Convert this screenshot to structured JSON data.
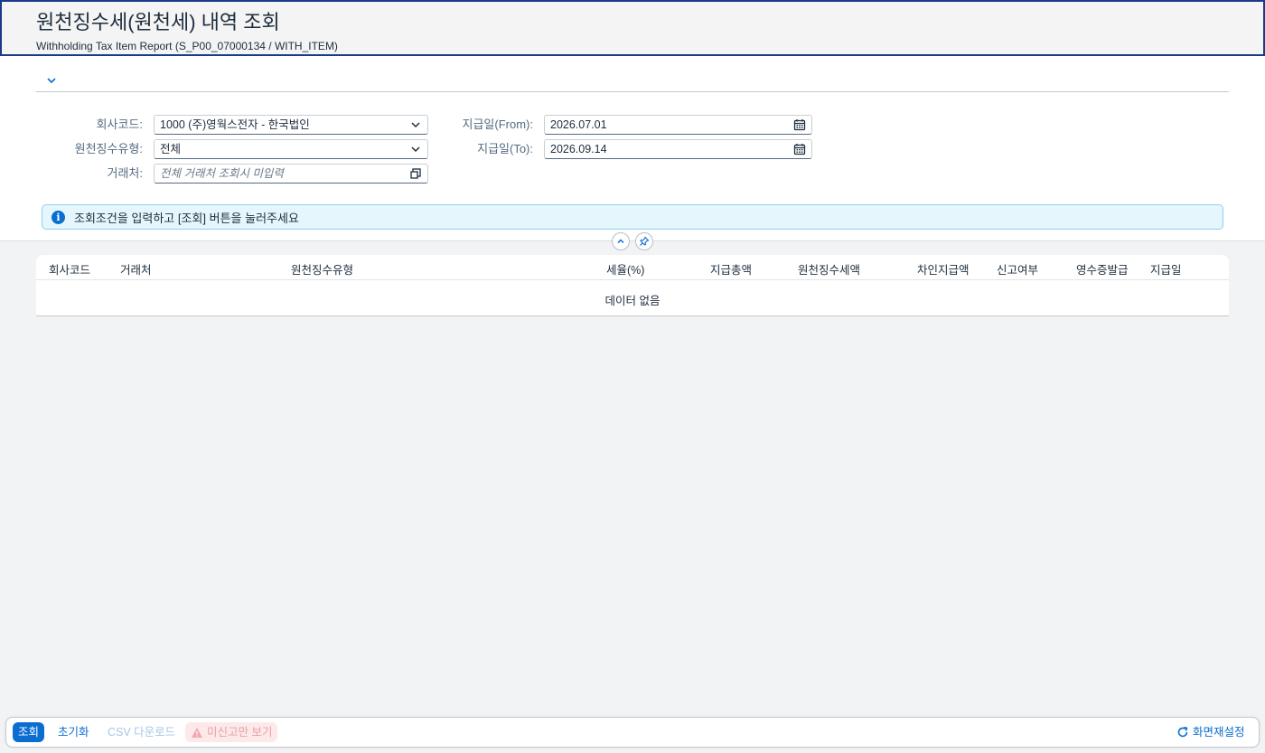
{
  "header": {
    "title": "원천징수세(원천세) 내역 조회",
    "subtitle": "Withholding Tax Item Report (S_P00_07000134 / WITH_ITEM)"
  },
  "filters": {
    "company_code": {
      "label": "회사코드:",
      "value": "1000 (주)영웍스전자 - 한국법인",
      "icon": "chevron-down-icon"
    },
    "withholding_type": {
      "label": "원천징수유형:",
      "value": "전체",
      "icon": "chevron-down-icon"
    },
    "vendor": {
      "label": "거래처:",
      "placeholder": "전체 거래처 조회시 미입력",
      "icon": "value-help-icon"
    },
    "pay_date_from": {
      "label": "지급일(From):",
      "value": "2026.07.01",
      "icon": "calendar-icon"
    },
    "pay_date_to": {
      "label": "지급일(To):",
      "value": "2026.09.14",
      "icon": "calendar-icon"
    }
  },
  "info_strip": {
    "icon": "info-icon",
    "text": "조회조건을 입력하고 [조회] 버튼을 눌러주세요"
  },
  "table": {
    "columns": [
      "회사코드",
      "거래처",
      "원천징수유형",
      "세율(%)",
      "지급총액",
      "원천징수세액",
      "차인지급액",
      "신고여부",
      "영수증발급",
      "지급일"
    ],
    "no_data": "데이터 없음"
  },
  "footer": {
    "search": "조회",
    "reset": "초기화",
    "csv": "CSV 다운로드",
    "unreported": "미신고만 보기",
    "screen_reset": "화면재설정"
  },
  "colors": {
    "accent": "#0a6ed1",
    "header_border": "#1a3b8c",
    "info_bg": "#e5f6fd",
    "warn_bg": "#fde9ea"
  }
}
